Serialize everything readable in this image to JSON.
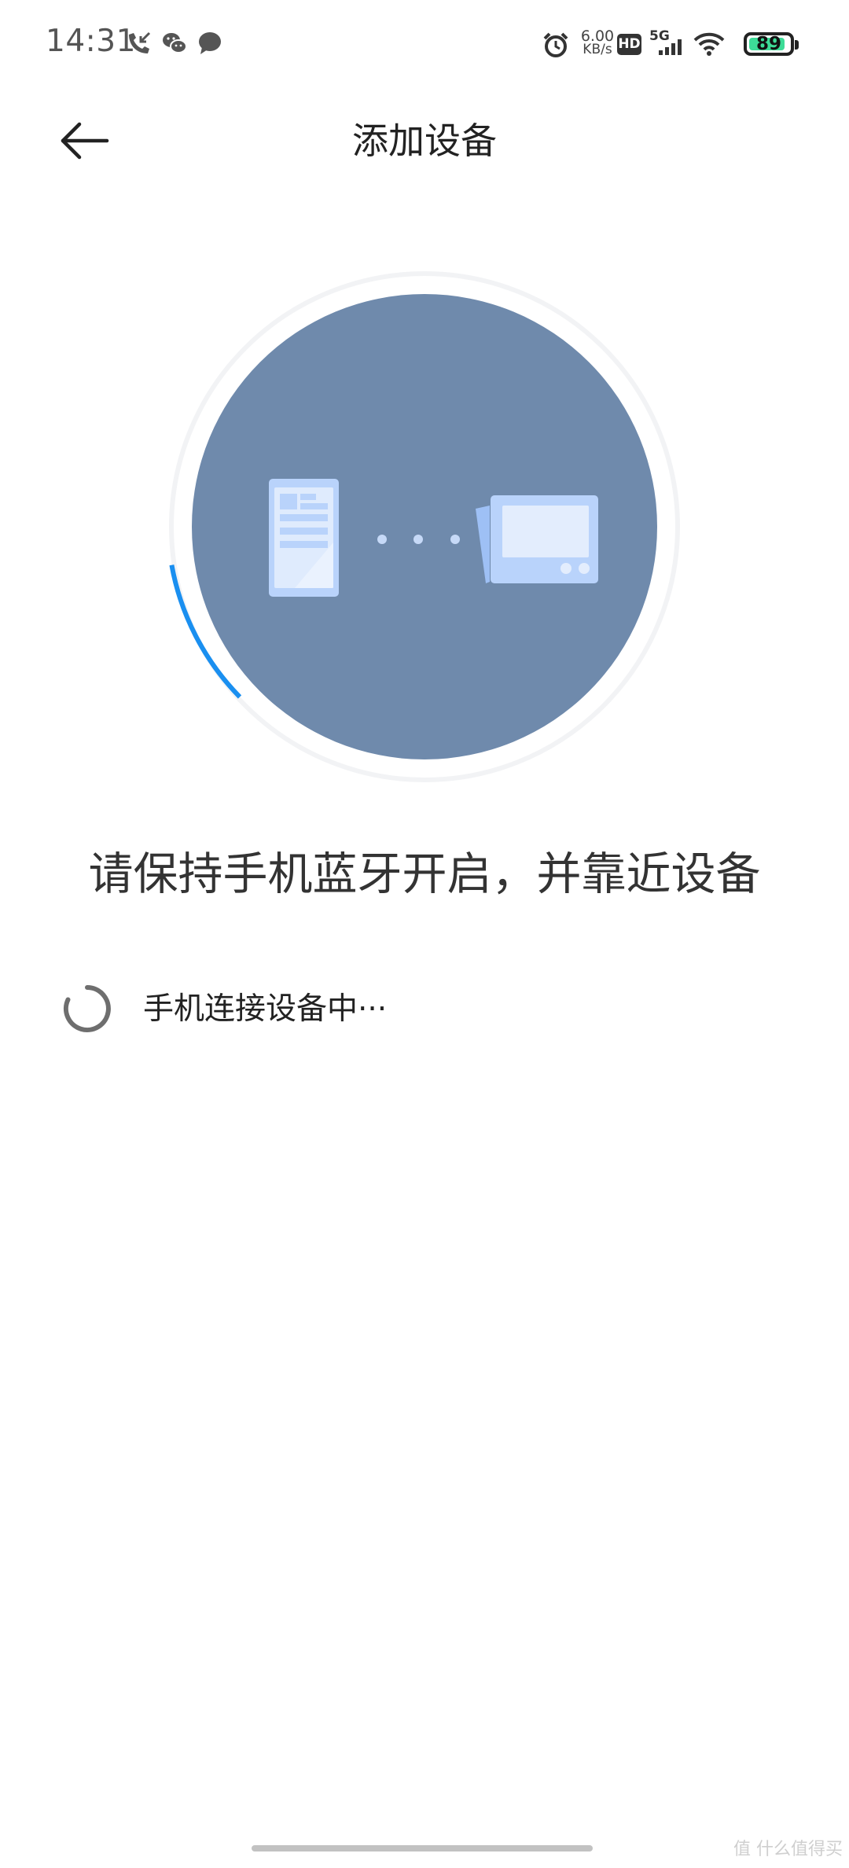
{
  "status_bar": {
    "time": "14:31",
    "left_icons": [
      "missed-call-icon",
      "wechat-icon",
      "message-icon"
    ],
    "right_icons": [
      "alarm-icon",
      "hd-icon",
      "5g-signal-icon",
      "wifi-icon",
      "battery-icon"
    ],
    "net_speed_value": "6.00",
    "net_speed_unit": "KB/s",
    "hd_label": "HD",
    "network_label": "5G",
    "battery_level": "89",
    "battery_color": "#3ddc97"
  },
  "header": {
    "title": "添加设备",
    "back_icon": "back-arrow-icon"
  },
  "illustration": {
    "circle_color": "#6f8aac",
    "progress_color": "#1a8ff0",
    "phone_icon": "phone-device-icon",
    "target_icon": "smart-device-icon",
    "connector": "dots-icon"
  },
  "main": {
    "instruction": "请保持手机蓝牙开启，并靠近设备",
    "status_text": "手机连接设备中···",
    "spinner_icon": "loading-spinner-icon"
  },
  "footer": {
    "watermark": "值 什么值得买"
  }
}
